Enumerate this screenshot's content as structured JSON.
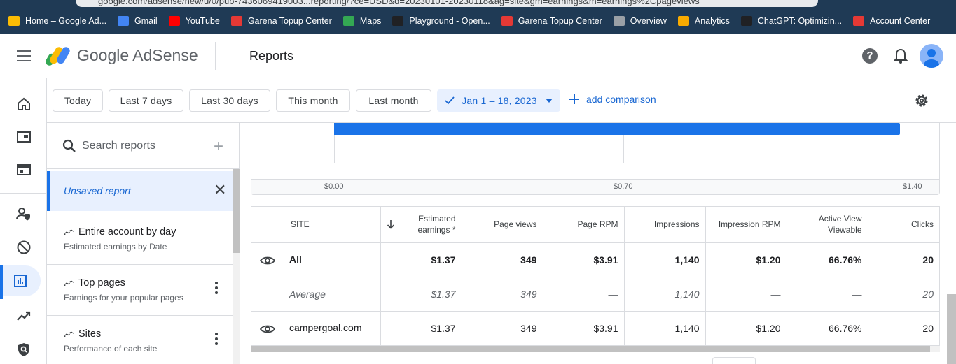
{
  "browser": {
    "url": "google.com/adsense/new/u/0/pub-7436069419003...reporting/?ce=USD&d=20230101-20230118&ag=site&gm=earnings&m=earnings%2Cpageviews",
    "bookmarks": [
      {
        "label": "Home – Google Ad...",
        "icon": "google-drive-icon",
        "color": "#fbbc04"
      },
      {
        "label": "Gmail",
        "icon": "gmail-icon",
        "color": "#4285f4"
      },
      {
        "label": "YouTube",
        "icon": "youtube-icon",
        "color": "#ff0000"
      },
      {
        "label": "Garena Topup Center",
        "icon": "garena-icon",
        "color": "#e53935"
      },
      {
        "label": "Maps",
        "icon": "maps-icon",
        "color": "#34a853"
      },
      {
        "label": "Playground - Open...",
        "icon": "openai-icon",
        "color": "#202124"
      },
      {
        "label": "Garena Topup Center",
        "icon": "garena-icon",
        "color": "#e53935"
      },
      {
        "label": "Overview",
        "icon": "store-icon",
        "color": "#9aa0a6"
      },
      {
        "label": "Analytics",
        "icon": "analytics-icon",
        "color": "#f9ab00"
      },
      {
        "label": "ChatGPT: Optimizin...",
        "icon": "openai-icon",
        "color": "#202124"
      },
      {
        "label": "Account Center",
        "icon": "garena-icon",
        "color": "#e53935"
      }
    ]
  },
  "header": {
    "product": "Google AdSense",
    "page_title": "Reports",
    "help_label": "?"
  },
  "date_chips": [
    {
      "label": "Today"
    },
    {
      "label": "Last 7 days"
    },
    {
      "label": "Last 30 days"
    },
    {
      "label": "This month"
    },
    {
      "label": "Last month"
    }
  ],
  "date_range": {
    "label": "Jan 1 – 18, 2023"
  },
  "add_comparison": "add comparison",
  "search": {
    "placeholder": "Search reports"
  },
  "side": {
    "unsaved_label": "Unsaved report",
    "reports": [
      {
        "title": "Entire account by day",
        "subtitle": "Estimated earnings by Date",
        "has_menu": false
      },
      {
        "title": "Top pages",
        "subtitle": "Earnings for your popular pages",
        "has_menu": true
      },
      {
        "title": "Sites",
        "subtitle": "Performance of each site",
        "has_menu": true
      }
    ]
  },
  "chart_data": {
    "type": "bar",
    "orientation": "horizontal",
    "categories": [
      "campergoal.com"
    ],
    "values": [
      1.37
    ],
    "xlim": [
      0,
      1.4
    ],
    "ticks": [
      "$0.00",
      "$0.70",
      "$1.40"
    ],
    "tick_values": [
      0,
      0.7,
      1.4
    ],
    "bar_color": "#1a73e8",
    "grid": true
  },
  "table": {
    "headers": {
      "site": "SITE",
      "earnings": "Estimated earnings *",
      "pageviews": "Page views",
      "page_rpm": "Page RPM",
      "impressions": "Impressions",
      "impression_rpm": "Impression RPM",
      "active_view": "Active View Viewable",
      "clicks": "Clicks"
    },
    "rows": [
      {
        "site": "All",
        "earnings": "$1.37",
        "pageviews": "349",
        "page_rpm": "$3.91",
        "impressions": "1,140",
        "impression_rpm": "$1.20",
        "active_view": "66.76%",
        "clicks": "20"
      },
      {
        "site": "Average",
        "earnings": "$1.37",
        "pageviews": "349",
        "page_rpm": "—",
        "impressions": "1,140",
        "impression_rpm": "—",
        "active_view": "—",
        "clicks": "20"
      },
      {
        "site": "campergoal.com",
        "earnings": "$1.37",
        "pageviews": "349",
        "page_rpm": "$3.91",
        "impressions": "1,140",
        "impression_rpm": "$1.20",
        "active_view": "66.76%",
        "clicks": "20"
      }
    ]
  }
}
